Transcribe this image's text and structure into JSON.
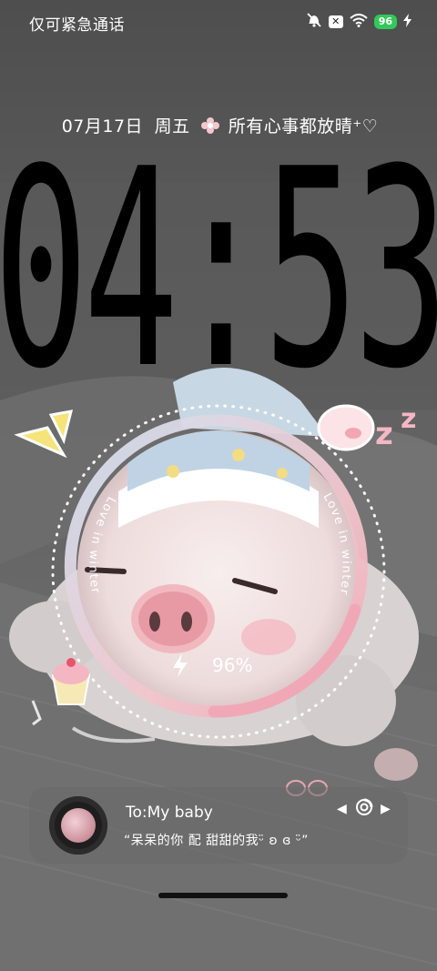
{
  "status_bar": {
    "carrier": "仅可紧急通话",
    "battery": "96",
    "icons": [
      "mute-bell-icon",
      "x-badge-icon",
      "wifi-icon",
      "battery-icon",
      "charging-bolt-icon"
    ]
  },
  "lock": {
    "date": "07月17日",
    "weekday": "周五",
    "motto": "所有心事都放晴",
    "motto_decor": "⁺♡",
    "time": "04:53"
  },
  "widget": {
    "arc_text_left": "Love in winter",
    "arc_text_right": "Love in winter",
    "battery_percent": "96%",
    "battery_level": 0.96,
    "ring_colors": [
      "#cfe3f2",
      "#f2c6cd",
      "#f0a8b6"
    ]
  },
  "music": {
    "title": "To:My baby",
    "lyric": "“呆呆的你 配 甜甜的我ᵕ̈ ʚ ɞ ᵕ̈”",
    "controls": [
      "previous-icon",
      "vinyl-icon",
      "next-icon"
    ]
  },
  "colors": {
    "accent_battery": "#34c759",
    "clock": "#000000"
  }
}
